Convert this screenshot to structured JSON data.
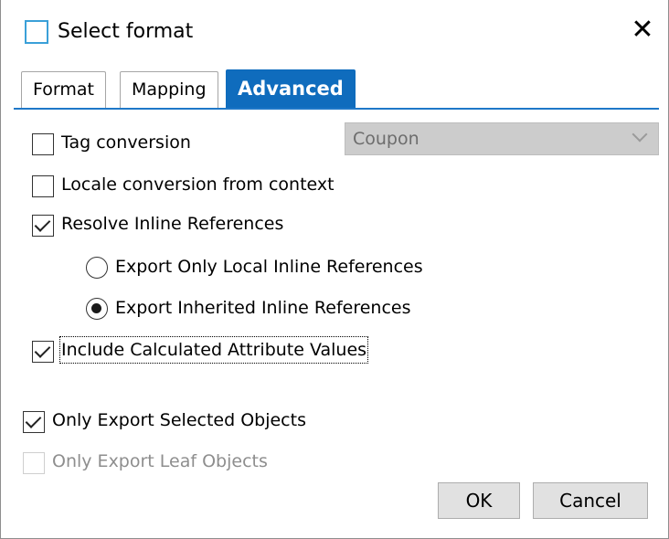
{
  "window": {
    "title": "Select format",
    "close_glyph": "✕"
  },
  "tabs": [
    {
      "label": "Format",
      "active": false
    },
    {
      "label": "Mapping",
      "active": false
    },
    {
      "label": "Advanced",
      "active": true
    }
  ],
  "options": {
    "tag_conversion": {
      "label": "Tag conversion",
      "checked": false
    },
    "tag_conversion_select": {
      "value": "Coupon",
      "enabled": false
    },
    "locale_conversion": {
      "label": "Locale conversion from context",
      "checked": false
    },
    "resolve_inline": {
      "label": "Resolve Inline References",
      "checked": true
    },
    "export_local_inline": {
      "label": "Export Only Local Inline References",
      "selected": false
    },
    "export_inherited_inline": {
      "label": "Export Inherited Inline References",
      "selected": true
    },
    "include_calculated": {
      "label": "Include Calculated Attribute Values",
      "checked": true
    },
    "only_selected": {
      "label": "Only Export Selected Objects",
      "checked": true
    },
    "only_leaf": {
      "label": "Only Export Leaf Objects",
      "checked": false,
      "enabled": false
    }
  },
  "buttons": {
    "ok": "OK",
    "cancel": "Cancel"
  },
  "colors": {
    "accent": "#0f6cbd",
    "title_icon": "#3aa0d8"
  }
}
